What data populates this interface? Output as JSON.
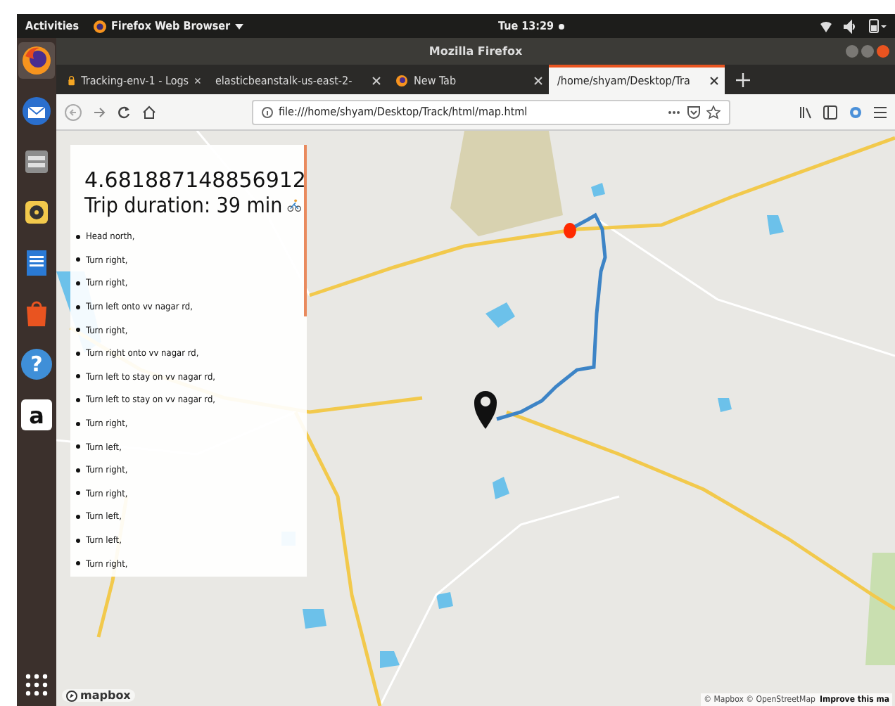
{
  "top_bar": {
    "activities": "Activities",
    "app_menu": "Firefox Web Browser",
    "clock": "Tue 13:29"
  },
  "dock": [
    {
      "kind": "firefox",
      "selected": true
    },
    {
      "kind": "mail",
      "selected": false
    },
    {
      "kind": "files",
      "selected": false
    },
    {
      "kind": "music",
      "selected": false
    },
    {
      "kind": "writer",
      "selected": false
    },
    {
      "kind": "store",
      "selected": false
    },
    {
      "kind": "help",
      "glyph": "?",
      "selected": false
    },
    {
      "kind": "amazon",
      "glyph": "a",
      "selected": false
    }
  ],
  "window": {
    "title": "Mozilla Firefox"
  },
  "tabs": [
    {
      "label": "Tracking-env-1 - Logs",
      "kind": "lock",
      "selected": false
    },
    {
      "label": "elasticbeanstalk-us-east-2-",
      "kind": "plain",
      "selected": false
    },
    {
      "label": "New Tab",
      "kind": "firefox",
      "selected": false
    },
    {
      "label": "/home/shyam/Desktop/Tra",
      "kind": "plain",
      "selected": true
    }
  ],
  "address_bar": {
    "value": "file:///home/shyam/Desktop/Track/html/map.html"
  },
  "route_panel": {
    "distance": "4.681887148856912",
    "duration": "Trip duration: 39 min",
    "steps": [
      "Head north,",
      "Turn right,",
      "Turn right,",
      "Turn left onto vv nagar rd,",
      "Turn right,",
      "Turn right onto vv nagar rd,",
      "Turn left to stay on vv nagar rd,",
      "Turn left to stay on vv nagar rd,",
      "Turn right,",
      "Turn left,",
      "Turn right,",
      "Turn right,",
      "Turn left,",
      "Turn left,",
      "Turn right,"
    ]
  },
  "map": {
    "logo": "mapbox",
    "attribution": "© Mapbox © OpenStreetMap",
    "improve_link": "Improve this ma"
  }
}
